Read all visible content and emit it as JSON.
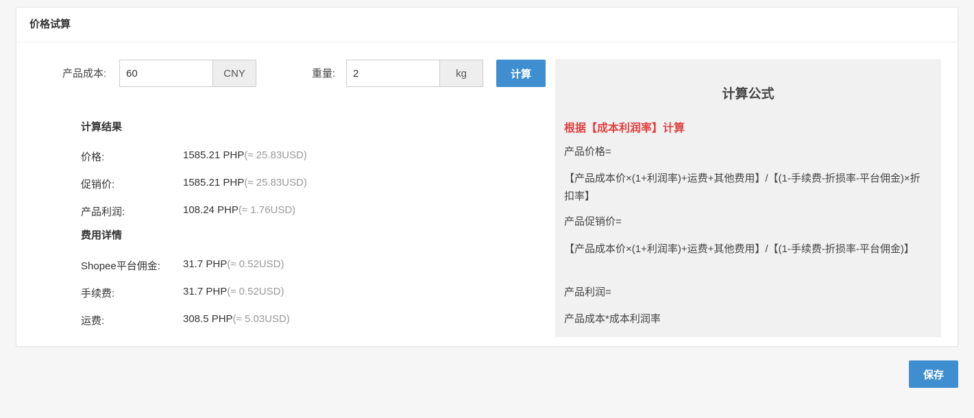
{
  "header": {
    "title": "价格试算"
  },
  "form": {
    "cost_label": "产品成本:",
    "cost_value": "60",
    "cost_unit": "CNY",
    "weight_label": "重量:",
    "weight_value": "2",
    "weight_unit": "kg",
    "calc_button": "计算"
  },
  "results": {
    "title": "计算结果",
    "rows": [
      {
        "label": "价格:",
        "value": "1585.21  PHP",
        "usd": "(≈ 25.83USD)"
      },
      {
        "label": "促销价:",
        "value": "1585.21  PHP",
        "usd": "(≈ 25.83USD)"
      },
      {
        "label": "产品利润:",
        "value": "108.24  PHP",
        "usd": "(≈ 1.76USD)"
      }
    ]
  },
  "fees": {
    "title": "费用详情",
    "rows": [
      {
        "label": "Shopee平台佣金:",
        "value": "31.7  PHP",
        "usd": "(≈ 0.52USD)"
      },
      {
        "label": "手续费:",
        "value": "31.7  PHP",
        "usd": "(≈ 0.52USD)"
      },
      {
        "label": "运费:",
        "value": "308.5  PHP",
        "usd": "(≈ 5.03USD)"
      }
    ]
  },
  "formula": {
    "title": "计算公式",
    "subtitle": "根据【成本利润率】计算",
    "price_label": "产品价格=",
    "price_formula": "【产品成本价×(1+利润率)+运费+其他费用】/【(1-手续费-折损率-平台佣金)×折扣率】",
    "promo_label": "产品促销价=",
    "promo_formula": "【产品成本价×(1+利润率)+运费+其他费用】/【(1-手续费-折损率-平台佣金)】",
    "profit_label": "产品利润=",
    "profit_formula": "产品成本*成本利润率"
  },
  "footer": {
    "save_button": "保存"
  },
  "colors": {
    "accent": "#3e8ed0",
    "highlight": "#e04040",
    "formula_bg": "#f1f1f1"
  }
}
